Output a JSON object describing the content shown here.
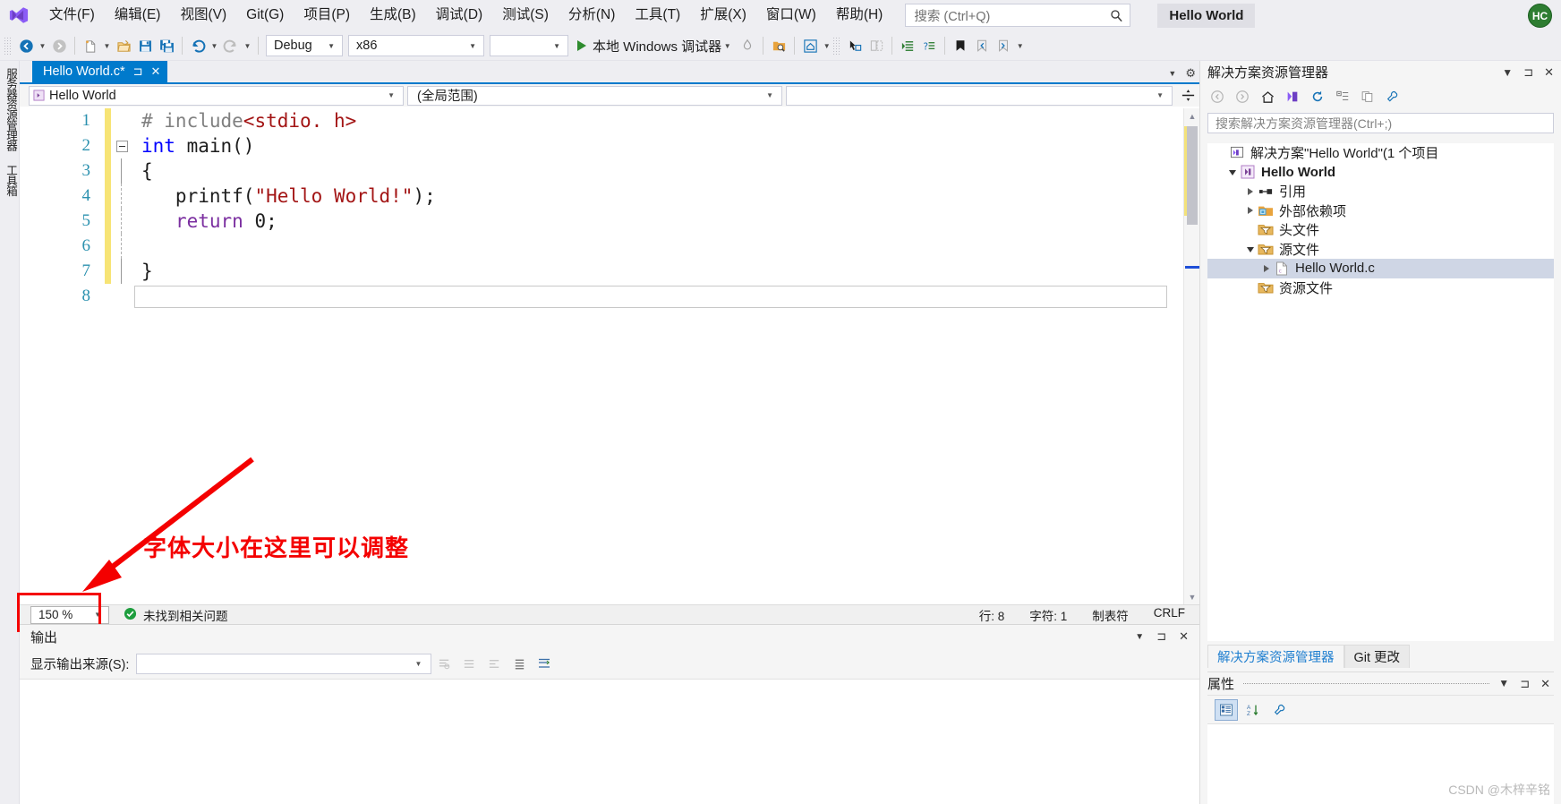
{
  "menubar": {
    "logo_icon": "visual-studio-logo",
    "items": [
      {
        "label": "文件(F)",
        "mnemonic": "F"
      },
      {
        "label": "编辑(E)",
        "mnemonic": "E"
      },
      {
        "label": "视图(V)",
        "mnemonic": "V"
      },
      {
        "label": "Git(G)",
        "mnemonic": "G"
      },
      {
        "label": "项目(P)",
        "mnemonic": "P"
      },
      {
        "label": "生成(B)",
        "mnemonic": "B"
      },
      {
        "label": "调试(D)",
        "mnemonic": "D"
      },
      {
        "label": "测试(S)",
        "mnemonic": "S"
      },
      {
        "label": "分析(N)",
        "mnemonic": "N"
      },
      {
        "label": "工具(T)",
        "mnemonic": "T"
      },
      {
        "label": "扩展(X)",
        "mnemonic": "X"
      },
      {
        "label": "窗口(W)",
        "mnemonic": "W"
      },
      {
        "label": "帮助(H)",
        "mnemonic": "H"
      }
    ],
    "search": {
      "placeholder": "搜索 (Ctrl+Q)",
      "value": "",
      "icon": "search-icon"
    },
    "solution_pill": "Hello World",
    "avatar_initials": "HC"
  },
  "toolbar": {
    "nav_back_icon": "arrow-back-icon",
    "nav_forward_icon": "arrow-forward-icon",
    "new_item_icon": "new-file-icon",
    "open_icon": "open-folder-icon",
    "save_icon": "save-icon",
    "save_all_icon": "save-all-icon",
    "undo_icon": "undo-icon",
    "redo_icon": "redo-icon",
    "configuration": "Debug",
    "platform": "x86",
    "extra_combo": "",
    "run_label": "本地 Windows 调试器",
    "run_icon": "play-icon",
    "hot_reload_icon": "hot-reload-icon",
    "search_folder_icon": "find-in-files-icon",
    "home_icon": "home-icon",
    "select_tool_icon": "pointer-icon",
    "compare_icon": "compare-icon",
    "indent_icon": "indent-icon",
    "comment_icon": "comment-icon",
    "bookmark_icon": "bookmark-icon",
    "prev_bookmark_icon": "prev-bookmark-icon",
    "next_bookmark_icon": "next-bookmark-icon"
  },
  "left_rail": {
    "items": [
      "服务器资源管理器",
      "工具箱"
    ]
  },
  "editor": {
    "tab": {
      "title": "Hello World.c*",
      "pin_icon": "pin-icon",
      "close_icon": "close-icon"
    },
    "nav_scope": "Hello World",
    "nav_member": "(全局范围)",
    "nav_third": "",
    "splitter_icon": "split-window-icon",
    "lines": [
      {
        "number": "1",
        "change": "yellow",
        "fold": "none",
        "tokens": [
          {
            "t": "# include",
            "c": "gray"
          },
          {
            "t": "<stdio. h>",
            "c": "str-red"
          }
        ]
      },
      {
        "number": "2",
        "change": "yellow",
        "fold": "box",
        "tokens": [
          {
            "t": "int ",
            "c": "kw-blue"
          },
          {
            "t": "main()",
            "c": "num"
          }
        ]
      },
      {
        "number": "3",
        "change": "yellow",
        "fold": "line",
        "tokens": [
          {
            "t": "{",
            "c": "num"
          }
        ]
      },
      {
        "number": "4",
        "change": "yellow",
        "fold": "dash",
        "tokens": [
          {
            "t": "   printf(",
            "c": "num"
          },
          {
            "t": "\"Hello World!\"",
            "c": "str-red"
          },
          {
            "t": ");",
            "c": "num"
          }
        ]
      },
      {
        "number": "5",
        "change": "yellow",
        "fold": "dash",
        "tokens": [
          {
            "t": "   ",
            "c": "num"
          },
          {
            "t": "return ",
            "c": "kw-purple"
          },
          {
            "t": "0;",
            "c": "num"
          }
        ]
      },
      {
        "number": "6",
        "change": "yellow",
        "fold": "dash",
        "tokens": [
          {
            "t": "",
            "c": "num"
          }
        ]
      },
      {
        "number": "7",
        "change": "yellow",
        "fold": "line",
        "tokens": [
          {
            "t": "}",
            "c": "num"
          }
        ]
      },
      {
        "number": "8",
        "change": "none",
        "fold": "none",
        "tokens": [
          {
            "t": "",
            "c": "num"
          }
        ]
      }
    ]
  },
  "status": {
    "zoom_value": "150 %",
    "issue_icon": "check-circle-icon",
    "issue_text": "未找到相关问题",
    "line_label": "行: 8",
    "char_label": "字符: 1",
    "tab_label": "制表符",
    "eol_label": "CRLF"
  },
  "annotation": {
    "text": "字体大小在这里可以调整",
    "color": "#f40000"
  },
  "output": {
    "title": "输出",
    "chevron_icon": "chevron-down-icon",
    "pin_icon": "pin-icon",
    "close_icon": "close-icon",
    "source_label": "显示输出来源(S):",
    "source_value": "",
    "buttons": [
      "find-icon",
      "clear-all-icon",
      "clear-icon",
      "list-icon",
      "wrap-icon"
    ]
  },
  "solution_explorer": {
    "title": "解决方案资源管理器",
    "head_icons": [
      "chevron-down-icon",
      "pin-icon",
      "close-icon"
    ],
    "toolbar_icons": [
      "arrow-back-icon",
      "arrow-forward-icon",
      "home-icon",
      "sync-with-editor-icon",
      "refresh-icon",
      "collapse-all-icon",
      "show-all-files-icon",
      "properties-icon"
    ],
    "search_placeholder": "搜索解决方案资源管理器(Ctrl+;)",
    "tree": [
      {
        "label": "解决方案\"Hello World\"(1 个项目",
        "indent": 0,
        "twisty": "none",
        "icon": "solution-icon",
        "bold": false,
        "selected": false
      },
      {
        "label": "Hello World",
        "indent": 1,
        "twisty": "down",
        "icon": "project-icon",
        "bold": true,
        "selected": false
      },
      {
        "label": "引用",
        "indent": 2,
        "twisty": "right",
        "icon": "references-icon",
        "bold": false,
        "selected": false
      },
      {
        "label": "外部依赖项",
        "indent": 2,
        "twisty": "right",
        "icon": "ext-deps-icon",
        "bold": false,
        "selected": false
      },
      {
        "label": "头文件",
        "indent": 2,
        "twisty": "none",
        "icon": "filter-folder-icon",
        "bold": false,
        "selected": false
      },
      {
        "label": "源文件",
        "indent": 2,
        "twisty": "down",
        "icon": "filter-folder-icon",
        "bold": false,
        "selected": false
      },
      {
        "label": "Hello World.c",
        "indent": 3,
        "twisty": "right",
        "icon": "c-file-icon",
        "bold": false,
        "selected": true
      },
      {
        "label": "资源文件",
        "indent": 2,
        "twisty": "none",
        "icon": "filter-folder-icon",
        "bold": false,
        "selected": false
      }
    ],
    "tabs": [
      {
        "label": "解决方案资源管理器",
        "active": true
      },
      {
        "label": "Git 更改",
        "active": false
      }
    ]
  },
  "properties": {
    "title": "属性",
    "head_icons": [
      "chevron-down-icon",
      "pin-icon",
      "close-icon"
    ],
    "toolbar_icons": [
      "categorized-icon",
      "alphabetical-icon",
      "properties-wrench-icon"
    ]
  },
  "watermark": "CSDN @木梓辛铭",
  "colors": {
    "accent": "#007acc",
    "chrome": "#eeeef2",
    "annotation_red": "#f40000",
    "keyword_blue": "#0000ff",
    "keyword_purple": "#7b2fa0",
    "string_red": "#a31515",
    "line_number": "#2b91af",
    "change_bar_yellow": "#f7e475"
  }
}
